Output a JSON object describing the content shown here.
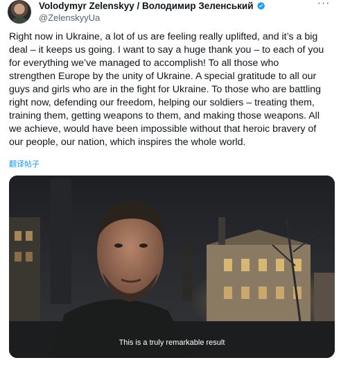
{
  "author": {
    "display_name": "Volodymyr Zelenskyy / Володимир Зеленський",
    "handle": "@ZelenskyyUa",
    "verified_icon": "verified-badge-icon",
    "verified_color": "#1d9bf0"
  },
  "menu": {
    "more_icon": "more-dots-icon",
    "label": "···"
  },
  "tweet": {
    "text": "Right now in Ukraine, a lot of us are feeling really uplifted, and it’s a big\ndeal – it keeps us going. I want to say a huge thank you – to each of you\nfor everything we’ve managed to accomplish! To all those who\nstrengthen Europe by the unity of Ukraine. A special gratitude to all our\nguys and girls who are in the fight for Ukraine. To those who are battling\nright now, defending our freedom, helping our soldiers – treating them,\ntraining them, getting weapons to them, and making those weapons. All\nwe achieve, would have been impossible without that heroic bravery of\nour people, our nation, which inspires the whole world.",
    "translate_label": "翻译帖子"
  },
  "video": {
    "caption": "This is a truly remarkable result"
  },
  "colors": {
    "text": "#0f1419",
    "secondary": "#536471",
    "link": "#1d9bf0"
  }
}
